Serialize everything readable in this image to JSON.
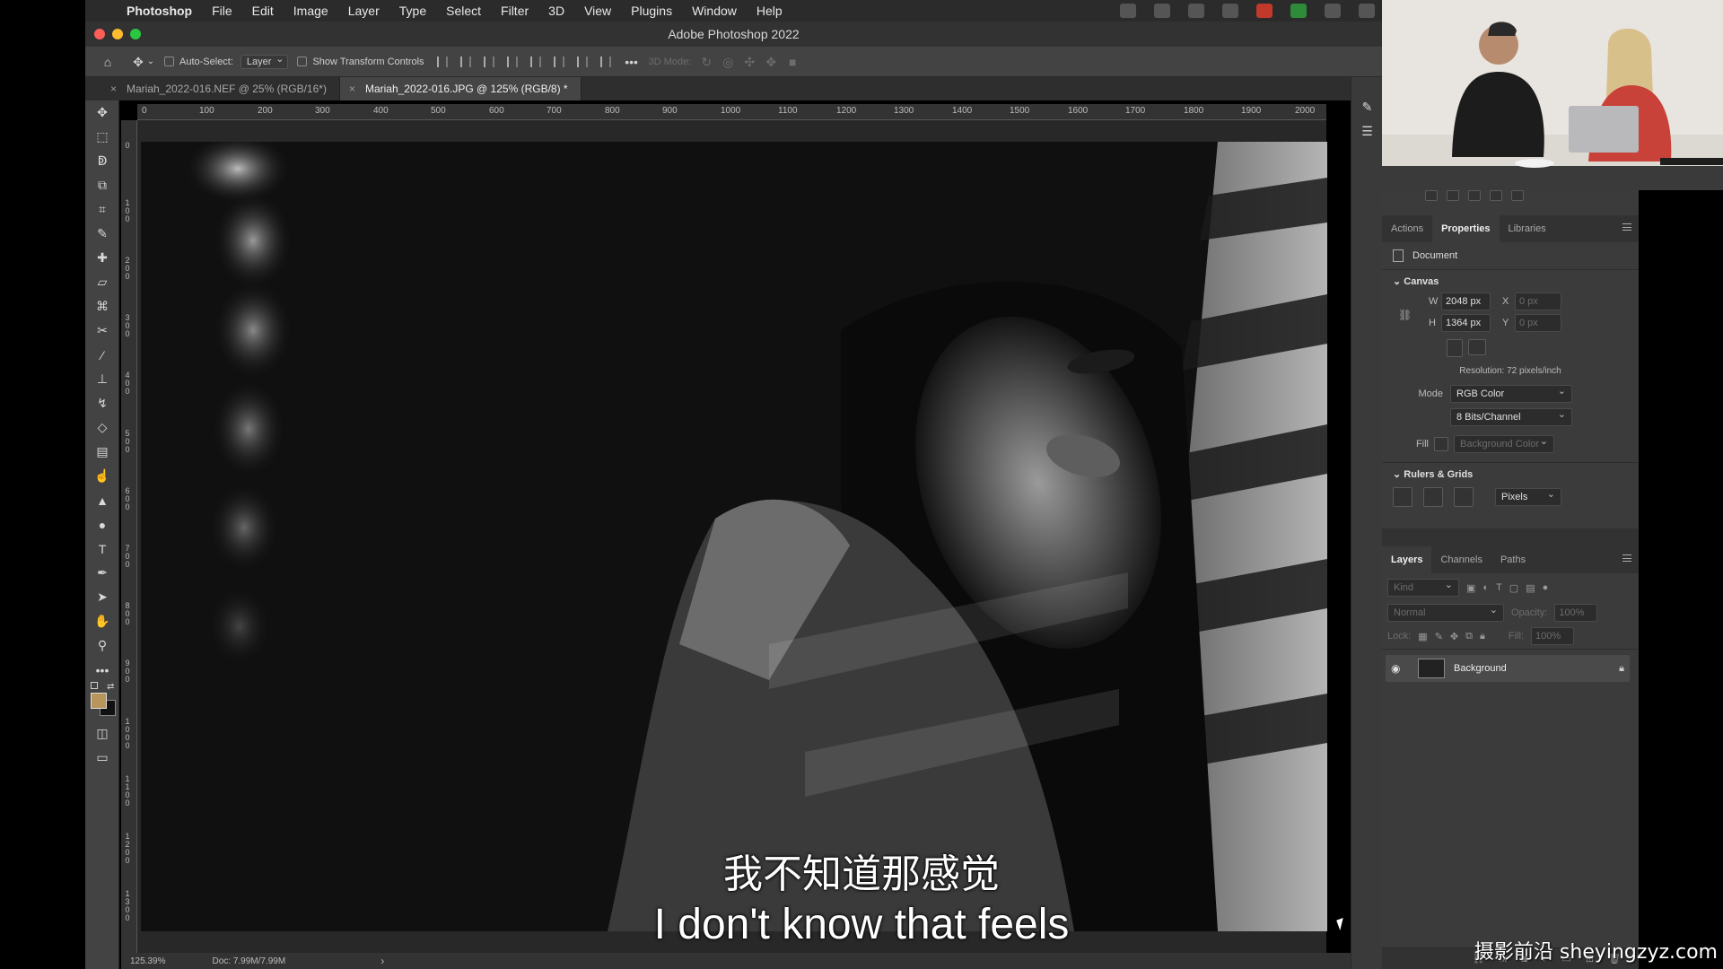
{
  "menubar": {
    "app": "Photoshop",
    "items": [
      "File",
      "Edit",
      "Image",
      "Layer",
      "Type",
      "Select",
      "Filter",
      "3D",
      "View",
      "Plugins",
      "Window",
      "Help"
    ]
  },
  "window": {
    "title": "Adobe Photoshop 2022"
  },
  "options": {
    "auto_select_label": "Auto-Select:",
    "auto_select_value": "Layer",
    "show_transform_label": "Show Transform Controls",
    "three_d_mode_label": "3D Mode:"
  },
  "tabs": [
    {
      "label": "Mariah_2022-016.NEF @ 25% (RGB/16*)",
      "close": "×"
    },
    {
      "label": "Mariah_2022-016.JPG @ 125% (RGB/8) *",
      "close": "×"
    }
  ],
  "ruler": {
    "h_ticks": [
      "0",
      "100",
      "200",
      "300",
      "400",
      "500",
      "600",
      "700",
      "800",
      "900",
      "1000",
      "1100",
      "1200",
      "1300",
      "1400",
      "1500",
      "1600",
      "1700",
      "1800",
      "1900",
      "2000"
    ],
    "v_ticks": [
      "0",
      "100",
      "200",
      "300",
      "400",
      "500",
      "600",
      "700",
      "800",
      "900",
      "1000",
      "1100",
      "1200",
      "1300"
    ]
  },
  "status": {
    "zoom": "125.39%",
    "doc": "Doc: 7.99M/7.99M",
    "arrow": "›"
  },
  "properties_panel": {
    "tabs": [
      "Actions",
      "Properties",
      "Libraries"
    ],
    "kind": "Document",
    "canvas_title": "Canvas",
    "w_label": "W",
    "w_value": "2048 px",
    "h_label": "H",
    "h_value": "1364 px",
    "x_label": "X",
    "x_placeholder": "0 px",
    "y_label": "Y",
    "y_placeholder": "0 px",
    "resolution": "Resolution: 72 pixels/inch",
    "mode_label": "Mode",
    "mode_value": "RGB Color",
    "bits_value": "8 Bits/Channel",
    "fill_label": "Fill",
    "fill_value": "Background Color",
    "rulers_title": "Rulers & Grids",
    "units_value": "Pixels"
  },
  "layers_panel": {
    "tabs": [
      "Layers",
      "Channels",
      "Paths"
    ],
    "kind_placeholder": "Kind",
    "blend_mode": "Normal",
    "opacity_label": "Opacity:",
    "opacity_value": "100%",
    "lock_label": "Lock:",
    "fill_label": "Fill:",
    "fill_value": "100%",
    "layers": [
      {
        "name": "Background",
        "visible": true,
        "locked": true
      }
    ]
  },
  "subtitles": {
    "zh": "我不知道那感觉",
    "en": "I don't know that feels"
  },
  "watermark": "摄影前沿 sheyingzyz.com",
  "colors": {
    "foreground_swatch": "#b8955a",
    "background_swatch": "#111111",
    "close": "#ff5f57",
    "minimize": "#febc2e",
    "zoom": "#28c840"
  }
}
